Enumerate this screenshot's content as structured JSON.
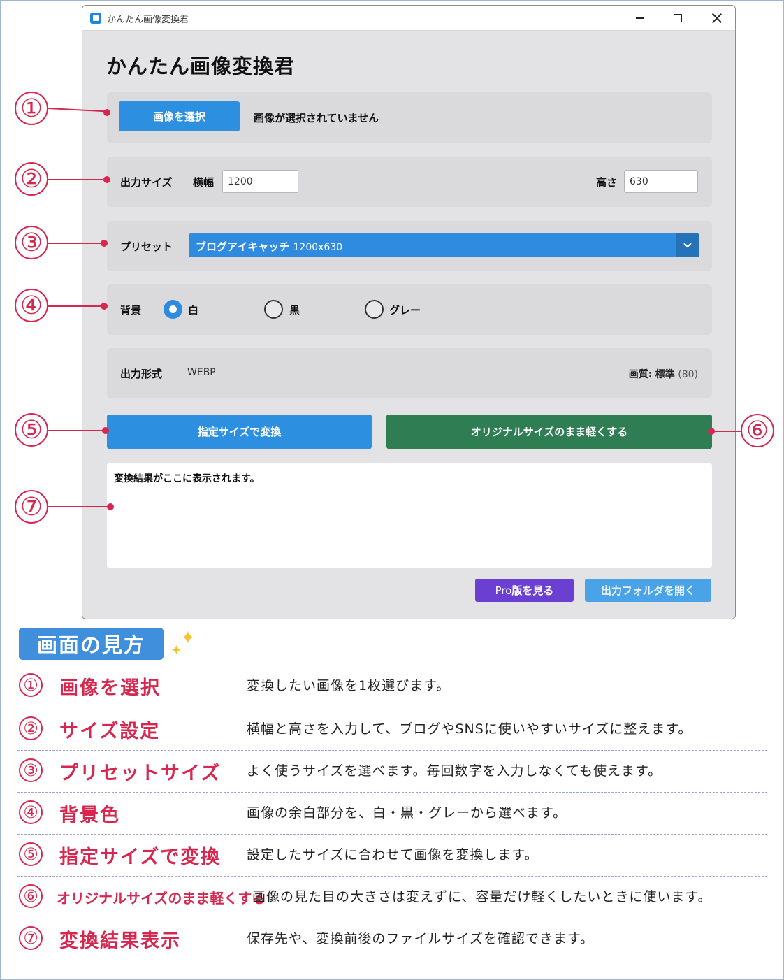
{
  "window": {
    "title": "かんたん画像変換君",
    "heading": "かんたん画像変換君"
  },
  "image_select": {
    "button_label": "画像を選択",
    "status": "画像が選択されていません"
  },
  "output_size": {
    "label": "出力サイズ",
    "width_label": "横幅",
    "width_value": "1200",
    "height_label": "高さ",
    "height_value": "630"
  },
  "preset": {
    "label": "プリセット",
    "selected_name": "ブログアイキャッチ",
    "selected_size": "1200x630"
  },
  "background": {
    "label": "背景",
    "options": [
      "白",
      "黒",
      "グレー"
    ],
    "selected": "白"
  },
  "output_format": {
    "label": "出力形式",
    "value": "WEBP",
    "quality_label": "画質:",
    "quality_value": "標準",
    "quality_number": "(80)"
  },
  "actions": {
    "convert_label": "指定サイズで変換",
    "lighten_label": "オリジナルサイズのまま軽くする",
    "pro_label_pre": "Pro",
    "pro_label_post": "版を見る",
    "open_folder_label": "出力フォルダを開く"
  },
  "result": {
    "text": "変換結果がここに表示されます。"
  },
  "callouts": [
    "①",
    "②",
    "③",
    "④",
    "⑤",
    "⑥",
    "⑦"
  ],
  "legend": {
    "title": "画面の見方",
    "items": [
      {
        "num": "①",
        "name": "画像を選択",
        "desc": "変換したい画像を1枚選びます。"
      },
      {
        "num": "②",
        "name": "サイズ設定",
        "desc": "横幅と高さを入力して、ブログやSNSに使いやすいサイズに整えます。"
      },
      {
        "num": "③",
        "name": "プリセットサイズ",
        "desc": "よく使うサイズを選べます。毎回数字を入力しなくても使えます。"
      },
      {
        "num": "④",
        "name": "背景色",
        "desc": "画像の余白部分を、白・黒・グレーから選べます。"
      },
      {
        "num": "⑤",
        "name": "指定サイズで変換",
        "desc": "設定したサイズに合わせて画像を変換します。"
      },
      {
        "num": "⑥",
        "name": "オリジナルサイズのまま軽くする",
        "desc": "画像の見た目の大きさは変えずに、容量だけ軽くしたいときに使います。"
      },
      {
        "num": "⑦",
        "name": "変換結果表示",
        "desc": "保存先や、変換前後のファイルサイズを確認できます。"
      }
    ]
  },
  "colors": {
    "accent_blue": "#2c8fe0",
    "green": "#2e7d53",
    "purple": "#6a3fd1",
    "callout_red": "#d6274f"
  }
}
